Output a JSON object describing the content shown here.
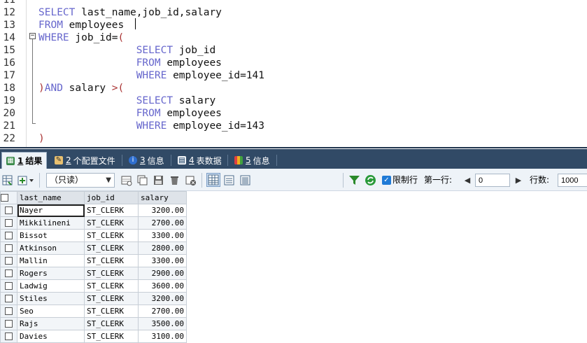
{
  "editor": {
    "lines": [
      {
        "num": "12",
        "indent": "",
        "tokens": [
          {
            "t": "kw",
            "v": "SELECT"
          },
          {
            "t": "id",
            "v": " last_name,job_id,salary"
          }
        ]
      },
      {
        "num": "13",
        "indent": "",
        "tokens": [
          {
            "t": "kw",
            "v": "FROM"
          },
          {
            "t": "id",
            "v": " employees"
          }
        ]
      },
      {
        "num": "14",
        "indent": "",
        "tokens": [
          {
            "t": "kw",
            "v": "WHERE"
          },
          {
            "t": "id",
            "v": " job_id="
          },
          {
            "t": "pa",
            "v": "("
          }
        ]
      },
      {
        "num": "15",
        "indent": "                ",
        "tokens": [
          {
            "t": "kw",
            "v": "SELECT"
          },
          {
            "t": "id",
            "v": " job_id"
          }
        ]
      },
      {
        "num": "16",
        "indent": "                ",
        "tokens": [
          {
            "t": "kw",
            "v": "FROM"
          },
          {
            "t": "id",
            "v": " employees"
          }
        ]
      },
      {
        "num": "17",
        "indent": "                ",
        "tokens": [
          {
            "t": "kw",
            "v": "WHERE"
          },
          {
            "t": "id",
            "v": " employee_id=141"
          }
        ]
      },
      {
        "num": "18",
        "indent": "",
        "tokens": [
          {
            "t": "pa",
            "v": ")"
          },
          {
            "t": "kw",
            "v": "AND"
          },
          {
            "t": "id",
            "v": " salary "
          },
          {
            "t": "pa",
            "v": ">("
          }
        ]
      },
      {
        "num": "19",
        "indent": "                ",
        "tokens": [
          {
            "t": "kw",
            "v": "SELECT"
          },
          {
            "t": "id",
            "v": " salary"
          }
        ]
      },
      {
        "num": "20",
        "indent": "                ",
        "tokens": [
          {
            "t": "kw",
            "v": "FROM"
          },
          {
            "t": "id",
            "v": " employees"
          }
        ]
      },
      {
        "num": "21",
        "indent": "                ",
        "tokens": [
          {
            "t": "kw",
            "v": "WHERE"
          },
          {
            "t": "id",
            "v": " employee_id=143"
          }
        ]
      },
      {
        "num": "22",
        "indent": "",
        "tokens": [
          {
            "t": "pa",
            "v": ")"
          }
        ]
      }
    ],
    "partial_top_line_num": "11",
    "fold_glyph": "−"
  },
  "tabs": [
    {
      "num": "1",
      "label": "结果",
      "icon": "table-icon",
      "active": true
    },
    {
      "num": "2",
      "label": "个配置文件",
      "icon": "profile-icon",
      "active": false
    },
    {
      "num": "3",
      "label": "信息",
      "icon": "info-icon",
      "active": false
    },
    {
      "num": "4",
      "label": "表数据",
      "icon": "table-data-icon",
      "active": false
    },
    {
      "num": "5",
      "label": "信息",
      "icon": "info-colored-icon",
      "active": false
    }
  ],
  "toolbar": {
    "mode_select": "（只读）",
    "limit_rows_label": "限制行",
    "first_row_label": "第一行:",
    "first_row_value": "0",
    "rows_label": "行数:",
    "rows_value": "1000"
  },
  "grid": {
    "columns": [
      "last_name",
      "job_id",
      "salary"
    ],
    "rows": [
      [
        "Nayer",
        "ST_CLERK",
        "3200.00"
      ],
      [
        "Mikkilineni",
        "ST_CLERK",
        "2700.00"
      ],
      [
        "Bissot",
        "ST_CLERK",
        "3300.00"
      ],
      [
        "Atkinson",
        "ST_CLERK",
        "2800.00"
      ],
      [
        "Mallin",
        "ST_CLERK",
        "3300.00"
      ],
      [
        "Rogers",
        "ST_CLERK",
        "2900.00"
      ],
      [
        "Ladwig",
        "ST_CLERK",
        "3600.00"
      ],
      [
        "Stiles",
        "ST_CLERK",
        "3200.00"
      ],
      [
        "Seo",
        "ST_CLERK",
        "2700.00"
      ],
      [
        "Rajs",
        "ST_CLERK",
        "3500.00"
      ],
      [
        "Davies",
        "ST_CLERK",
        "3100.00"
      ]
    ]
  },
  "colors": {
    "keyword": "#6666cc",
    "paren": "#aa3333",
    "tabbar": "#314a66",
    "toolbar": "#eef3f8"
  }
}
